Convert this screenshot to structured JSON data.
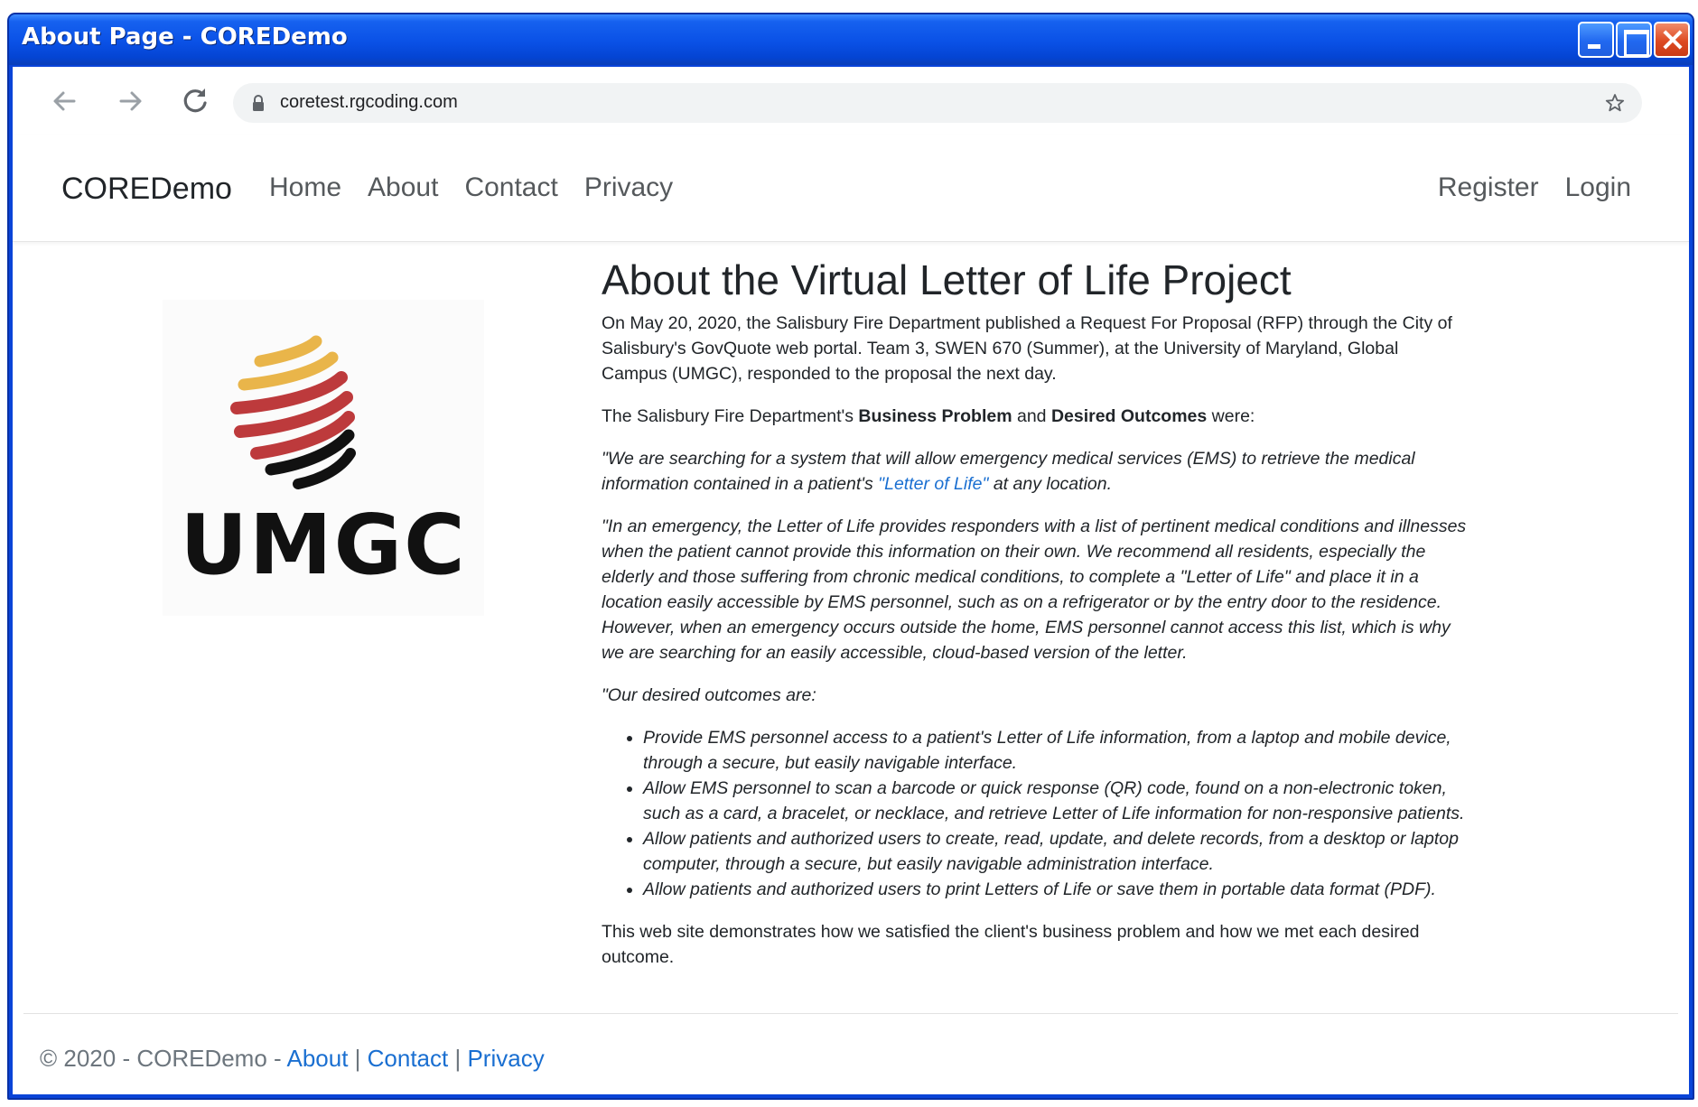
{
  "window": {
    "title": "About Page - COREDemo"
  },
  "browser": {
    "url": "coretest.rgcoding.com"
  },
  "navbar": {
    "brand": "COREDemo",
    "links": [
      {
        "label": "Home"
      },
      {
        "label": "About"
      },
      {
        "label": "Contact"
      },
      {
        "label": "Privacy"
      }
    ],
    "right_links": [
      {
        "label": "Register"
      },
      {
        "label": "Login"
      }
    ]
  },
  "logo": {
    "text": "UMGC",
    "colors": {
      "gold": "#e9b54a",
      "red": "#bd3a3c",
      "black": "#111111"
    }
  },
  "content": {
    "heading": "About the Virtual Letter of Life Project",
    "intro": "On May 20, 2020, the Salisbury Fire Department published a Request For Proposal (RFP) through the City of Salisbury's GovQuote web portal. Team 3, SWEN 670 (Summer), at the University of Maryland, Global Campus (UMGC), responded to the proposal the next day.",
    "problem_intro": {
      "pre": "The Salisbury Fire Department's ",
      "bold1": "Business Problem",
      "mid": " and ",
      "bold2": "Desired Outcomes",
      "post": " were:"
    },
    "quote1": {
      "pre": "\"We are searching for a system that will allow emergency medical services (EMS) to retrieve the medical information contained in a patient's ",
      "link": "\"Letter of Life\"",
      "post": " at any location."
    },
    "quote2": "\"In an emergency, the Letter of Life provides responders with a list of pertinent medical conditions and illnesses when the patient cannot provide this information on their own. We recommend all residents, especially the elderly and those suffering from chronic medical conditions, to complete a \"Letter of Life\" and place it in a location easily accessible by EMS personnel, such as on a refrigerator or by the entry door to the residence. However, when an emergency occurs outside the home, EMS personnel cannot access this list, which is why we are searching for an easily accessible, cloud-based version of the letter.",
    "outcomes_intro": "\"Our desired outcomes are:",
    "outcomes": [
      "Provide EMS personnel access to a patient's Letter of Life information, from a laptop and mobile device, through a secure, but easily navigable interface.",
      "Allow EMS personnel to scan a barcode or quick response (QR) code, found on a non-electronic token, such as a card, a bracelet, or necklace, and retrieve Letter of Life information for non-responsive patients.",
      "Allow patients and authorized users to create, read, update, and delete records, from a desktop or laptop computer, through a secure, but easily navigable administration interface.",
      "Allow patients and authorized users to print Letters of Life or save them in portable data format (PDF)."
    ],
    "closing": "This web site demonstrates how we satisfied the client's business problem and how we met each desired outcome."
  },
  "footer": {
    "copyright": "© 2020 - COREDemo - ",
    "about": "About",
    "sep1": " | ",
    "contact": "Contact",
    "sep2": " | ",
    "privacy": "Privacy"
  },
  "colors": {
    "title_bar": "#0a51e6",
    "link": "#1a6fd1",
    "text": "#212529",
    "muted": "#6c757d"
  }
}
